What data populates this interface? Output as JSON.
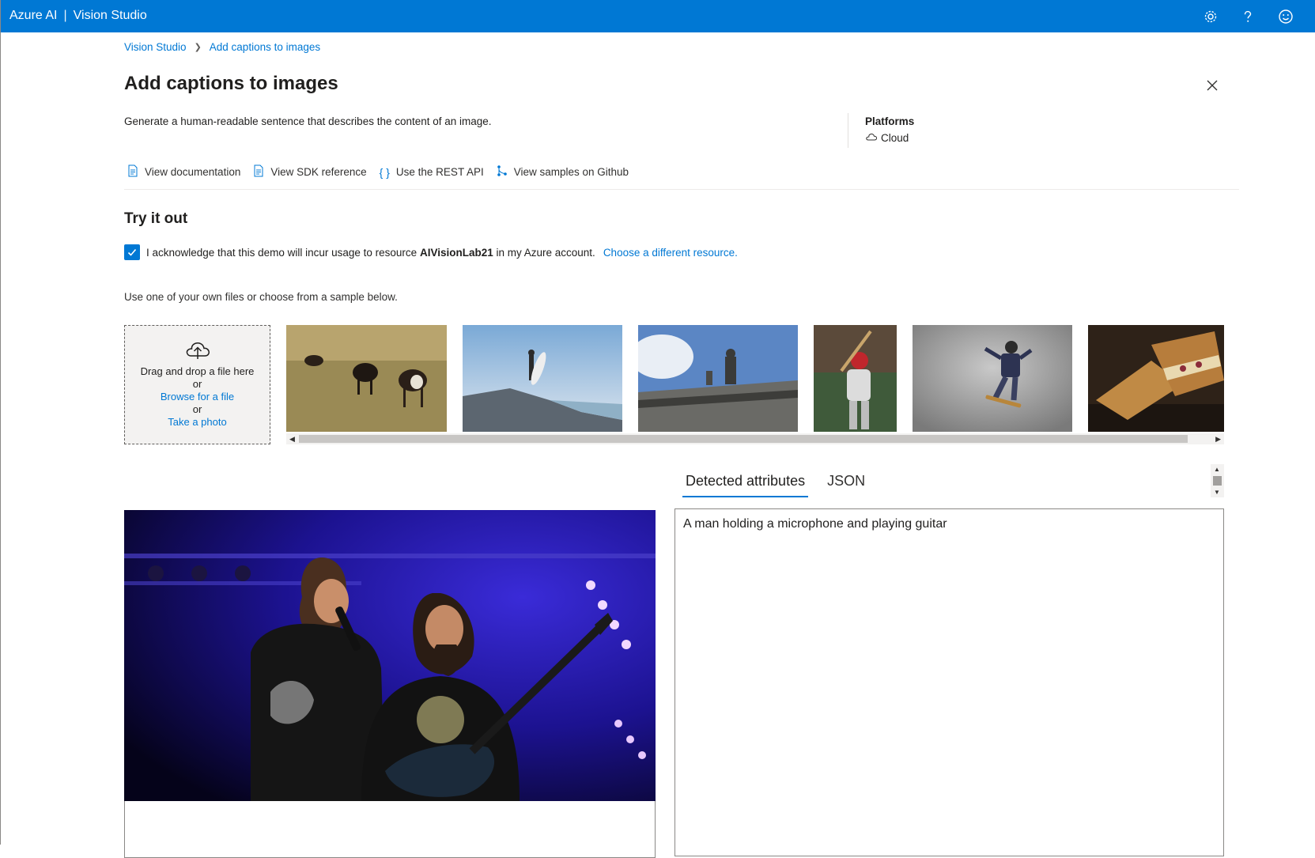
{
  "topbar": {
    "brand": "Azure AI",
    "separator": "|",
    "product": "Vision Studio",
    "icons": [
      "gear-icon",
      "help-icon",
      "feedback-smiley-icon"
    ]
  },
  "breadcrumb": {
    "root": "Vision Studio",
    "current": "Add captions to images"
  },
  "page": {
    "title": "Add captions to images",
    "description": "Generate a human-readable sentence that describes the content of an image.",
    "platforms_label": "Platforms",
    "platform": "Cloud"
  },
  "links": [
    {
      "label": "View documentation",
      "icon": "document-icon"
    },
    {
      "label": "View SDK reference",
      "icon": "document-icon"
    },
    {
      "label": "Use the REST API",
      "icon": "braces-icon"
    },
    {
      "label": "View samples on Github",
      "icon": "branch-icon"
    }
  ],
  "try_it_out": {
    "title": "Try it out",
    "ack_prefix": "I acknowledge that this demo will incur usage to resource",
    "resource": "AIVisionLab21",
    "ack_suffix": "in my Azure account.",
    "choose_link": "Choose a different resource.",
    "checked": true,
    "instructions": "Use one of your own files or choose from a sample below."
  },
  "dropzone": {
    "line1": "Drag and drop a file here",
    "or1": "or",
    "browse": "Browse for a file",
    "or2": "or",
    "photo": "Take a photo"
  },
  "samples": [
    "cows-grazing",
    "surfer-on-rock",
    "building-statue",
    "baseball-batter",
    "skateboarder",
    "grilled-sandwich"
  ],
  "results": {
    "tabs": [
      "Detected attributes",
      "JSON"
    ],
    "active_tab": "Detected attributes",
    "caption": "A man holding a microphone and playing guitar"
  },
  "colors": {
    "accent": "#0078d4",
    "topbar": "#0078d4",
    "text": "#201f1e"
  }
}
